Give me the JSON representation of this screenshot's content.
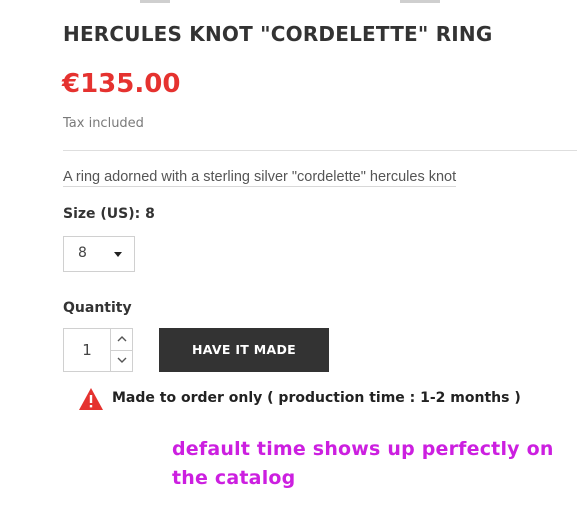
{
  "product": {
    "title": "HERCULES KNOT \"CORDELETTE\" RING",
    "price": "€135.00",
    "tax_note": "Tax included",
    "description": "A ring adorned with a sterling silver \"cordelette\" hercules knot"
  },
  "size": {
    "label": "Size (US): 8",
    "selected": "8"
  },
  "quantity": {
    "label": "Quantity",
    "value": "1"
  },
  "actions": {
    "have_it_made_label": "HAVE IT MADE"
  },
  "availability": {
    "message": "Made to order only ( production time : 1-2 months )",
    "icon": "warning-icon",
    "icon_color": "#e5322f"
  },
  "annotation": {
    "text": "default time shows up perfectly on the catalog",
    "color": "#cc1fe0"
  },
  "colors": {
    "price": "#e5322f",
    "button_bg": "#333333",
    "title": "#333333"
  }
}
